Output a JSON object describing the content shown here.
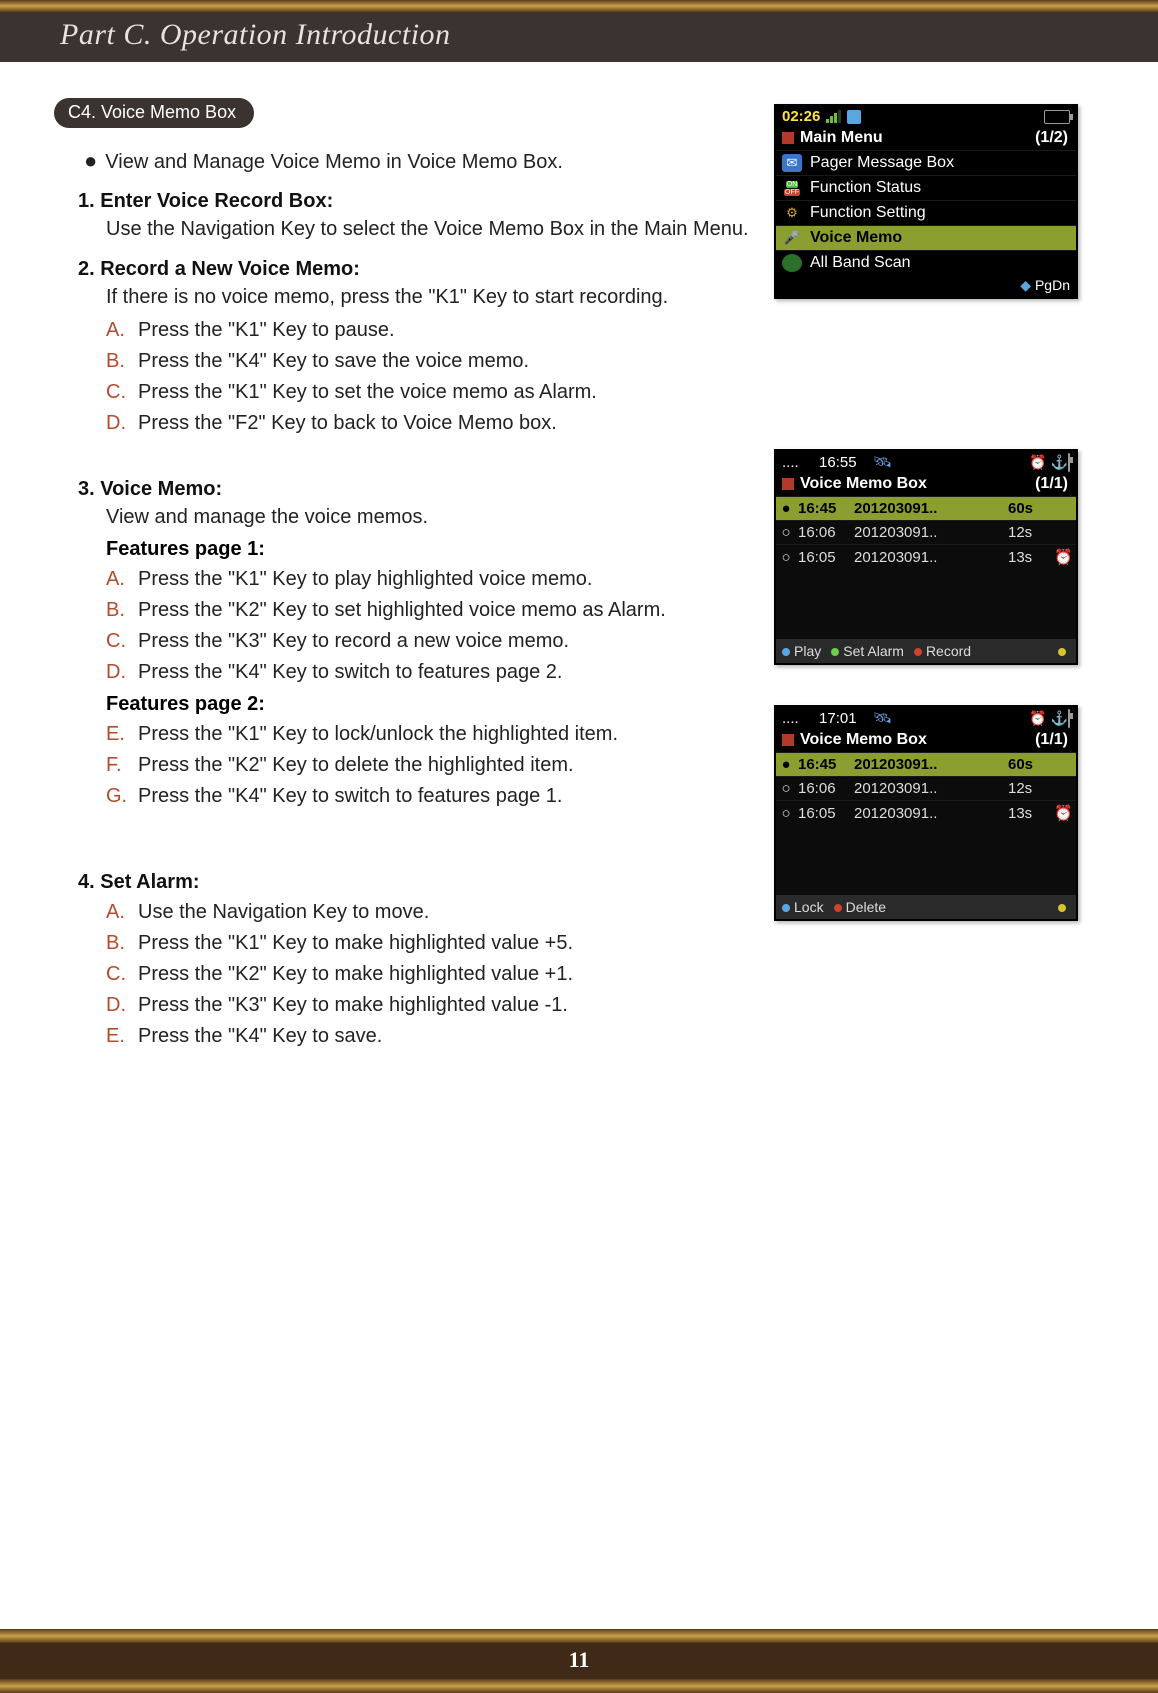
{
  "header": {
    "title": "Part C. Operation Introduction"
  },
  "section_tab": "C4. Voice Memo Box",
  "intro": "View and Manage Voice Memo in Voice Memo Box.",
  "steps": {
    "s1": {
      "head": "1. Enter Voice Record Box:",
      "body": "Use the Navigation Key to select the Voice Memo Box in the Main Menu."
    },
    "s2": {
      "head": "2. Record a New Voice Memo:",
      "body": "If there is no voice memo, press the  \"K1\" Key to start recording.",
      "items": [
        {
          "l": "A.",
          "t": "Press the \"K1\" Key to pause."
        },
        {
          "l": "B.",
          "t": "Press the \"K4\" Key to save the voice memo."
        },
        {
          "l": "C.",
          "t": "Press the \"K1\" Key to set the voice memo as Alarm."
        },
        {
          "l": "D.",
          "t": "Press the \"F2\" Key to back to Voice Memo box."
        }
      ]
    },
    "s3": {
      "head": "3. Voice Memo:",
      "body": "View and manage the voice memos.",
      "feat1_head": "Features page 1:",
      "feat1": [
        {
          "l": "A.",
          "t": "Press the \"K1\" Key to play highlighted voice memo."
        },
        {
          "l": "B.",
          "t": "Press the \"K2\" Key to set highlighted voice memo as Alarm."
        },
        {
          "l": "C.",
          "t": "Press the \"K3\" Key to record a new voice memo."
        },
        {
          "l": "D.",
          "t": "Press the \"K4\" Key to switch to features page 2."
        }
      ],
      "feat2_head": "Features page 2:",
      "feat2": [
        {
          "l": "E.",
          "t": "Press the \"K1\" Key to lock/unlock the highlighted item."
        },
        {
          "l": "F.",
          "t": "Press the \"K2\" Key to delete the highlighted item."
        },
        {
          "l": "G.",
          "t": "Press the \"K4\" Key to switch to features page 1."
        }
      ]
    },
    "s4": {
      "head": "4. Set Alarm:",
      "items": [
        {
          "l": "A.",
          "t": "Use the Navigation Key to move."
        },
        {
          "l": "B.",
          "t": "Press the \"K1\" Key to make highlighted value +5."
        },
        {
          "l": "C.",
          "t": "Press the \"K2\" Key to make highlighted value +1."
        },
        {
          "l": "D.",
          "t": "Press the \"K3\" Key to make highlighted value -1."
        },
        {
          "l": "E.",
          "t": "Press the \"K4\" Key to save."
        }
      ]
    }
  },
  "device_main": {
    "time": "02:26",
    "title": "Main Menu",
    "page": "(1/2)",
    "rows": [
      {
        "icon": "pager",
        "label": "Pager Message Box",
        "sel": false
      },
      {
        "icon": "onoff",
        "label": "Function Status",
        "sel": false
      },
      {
        "icon": "gear",
        "label": "Function Setting",
        "sel": false
      },
      {
        "icon": "voice",
        "label": "Voice Memo",
        "sel": true
      },
      {
        "icon": "globe",
        "label": "All Band Scan",
        "sel": false
      }
    ],
    "footer": "PgDn"
  },
  "device_vmb1": {
    "time": "16:55",
    "title": "Voice Memo Box",
    "page": "(1/1)",
    "rows": [
      {
        "mark": "●",
        "t": "16:45",
        "name": "201203091..",
        "dur": "60s",
        "alarm": false,
        "sel": true
      },
      {
        "mark": "○",
        "t": "16:06",
        "name": "201203091..",
        "dur": "12s",
        "alarm": false,
        "sel": false
      },
      {
        "mark": "○",
        "t": "16:05",
        "name": "201203091..",
        "dur": "13s",
        "alarm": true,
        "sel": false
      }
    ],
    "foot": [
      {
        "dot": "blue",
        "label": "Play"
      },
      {
        "dot": "green",
        "label": "Set Alarm"
      },
      {
        "dot": "red",
        "label": "Record"
      },
      {
        "dot": "yellow",
        "label": ""
      }
    ]
  },
  "device_vmb2": {
    "time": "17:01",
    "title": "Voice Memo Box",
    "page": "(1/1)",
    "rows": [
      {
        "mark": "●",
        "t": "16:45",
        "name": "201203091..",
        "dur": "60s",
        "alarm": false,
        "sel": true
      },
      {
        "mark": "○",
        "t": "16:06",
        "name": "201203091..",
        "dur": "12s",
        "alarm": false,
        "sel": false
      },
      {
        "mark": "○",
        "t": "16:05",
        "name": "201203091..",
        "dur": "13s",
        "alarm": true,
        "sel": false
      }
    ],
    "foot": [
      {
        "dot": "blue",
        "label": "Lock"
      },
      {
        "dot": "red",
        "label": "Delete"
      },
      {
        "dot": "yellow",
        "label": ""
      }
    ]
  },
  "page_number": "11"
}
